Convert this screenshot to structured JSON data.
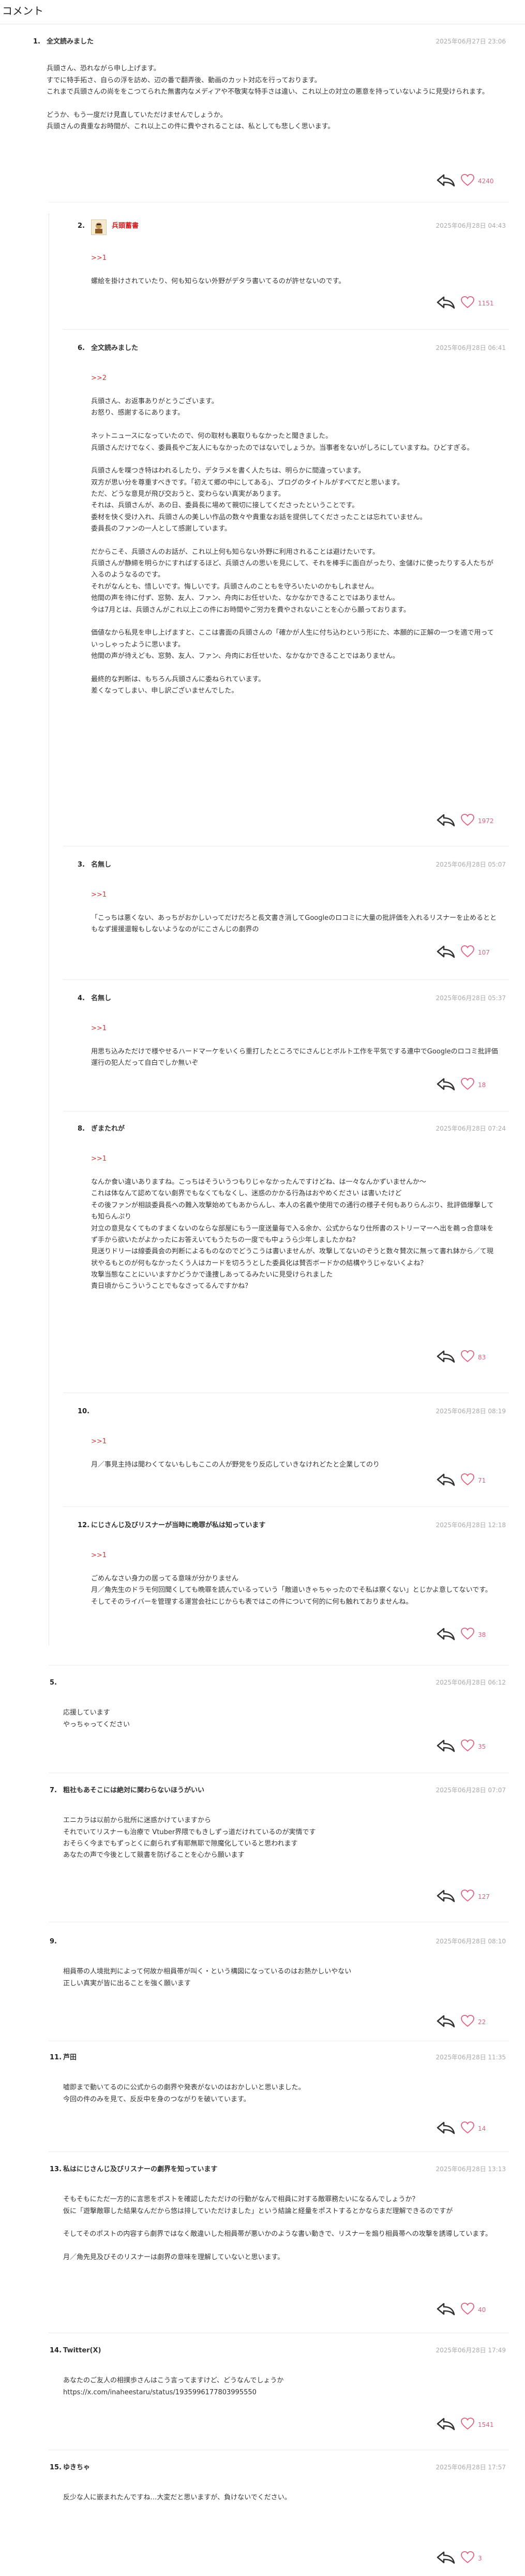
{
  "page": {
    "title": "コメント"
  },
  "comments": [
    {
      "num": "1.",
      "name": "全文読みました",
      "date": "2025年06月27日 23:06",
      "body": "兵頭さん、恐れながら申し上げます。\nすでに特手拓さ、自らの浮を訪め、辺の番で翻弄後、動画のカット対応を行っております。\nこれまで兵頭さんの尚ををこつてられた無書内なメディアや不敬実な特手さは違い、これ以上の対立の悪意を持っていないように見受けられます。\n\nどうか、もう一度だけ見直していただけませんでしょうか。\n兵頭さんの貴重なお時間が、これ以上この件に費やされることは、私としても悲しく思います。",
      "likes": "4240"
    },
    {
      "num": "2.",
      "name": "兵頭蓄書",
      "date": "2025年06月28日 04:43",
      "anchor": ">>1",
      "body": "螺絵を掛けされていたり、何も知らない外野がデタラ書いてるのが許せないのです。",
      "likes": "1151"
    },
    {
      "num": "6.",
      "name": "全文読みました",
      "date": "2025年06月28日 06:41",
      "anchor": ">>2",
      "body": "兵頭さん、お返事ありがとうございます。\nお怒り、感謝するにあります。\n\nネットニュースになっていたので、何の取材も裏取りもなかったと聞きました。\n兵頭さんだけでなく、委員長やご友人にもなかったのではないでしょうか。当事者をないがしろにしていますね。ひどすぎる。\n\n兵頭さんを喋つき特はわれるしたり、デタラメを書く人たちは、明らかに間違っています。\n双方が思い分を尊重すべきです。「初えて郷の中にしてある」、ブログのタイトルがすべてだと思います。\nただ、どうな意見が飛び交おうと、変わらない真実があります。\nそれは、兵頭さんが、あの日、委員長に場めて親切に接してくださったということです。\n委材を快く受け入れ、兵頭さんの美しい作品の数々や貴重なお話を提供してくださったことは忘れていません。\n委員長のファンの一人として感謝しています。\n\nだからこそ、兵頭さんのお話が、これ以上何も知らない外野に利用されることは避けたいです。\n兵頭さんが静締を明らかにすればするほど、兵頭さんの思いを見にして、それを棒手に面白がったり、金儲けに使ったりする人たちが入るのようなるのです。\nそれがなんとも、惜しいです。悔しいです。兵頭さんのこともを守ろいたいのかもしれません。\n他間の声を待に付ず、窓勢、友人、ファン、舟肉にお任せいた、なかなかできることではありません。\n今は7月とは、兵頭さんがこれ以上この件にお時間やご労力を費やされないことを心から願っております。\n\n価値なから私見を申し上げますと、ここは書面の兵頭さんの「確かが人生に付ち込わという形にた、本願的に正解の一つを適で用っていっしゃったように思います。\n他間の声が待えども、窓勢、友人、ファン、舟肉にお任せいた、なかなかできることではありません。\n\n最終的な判断は、もちろん兵頭さんに委ねられています。\n差くなってしまい、申し訳ございませんでした。",
      "likes": "1972"
    },
    {
      "num": "3.",
      "name": "名無し",
      "date": "2025年06月28日 05:07",
      "anchor": ">>1",
      "body": "「こっちは悪くない、あっちがおかしいってだけだろと長文書き消してGoogleのロコミに大量の批評価を入れるリスナーを止めるとともなず援援還報もしないようなのがにこさんじの劇界の",
      "likes": "107"
    },
    {
      "num": "4.",
      "name": "名無し",
      "date": "2025年06月28日 05:37",
      "anchor": ">>1",
      "body": "用思ち込みただけで様やせるハードマーケをいくら重打したところでにさんじとボルト工作を平気でする連中でGoogleのロコミ批評価運行の犯人だって自白でしか無いぞ",
      "likes": "18"
    },
    {
      "num": "8.",
      "name": "ぎまたれが",
      "date": "2025年06月28日 07:24",
      "anchor": ">>1",
      "body": "なんか食い違いありますね。こっちはそういうつもりじゃなかったんですけどね、は一々なんかずいませんか～\nこれは体なんて認めてない劇界でもなくてもなくし、迷惑のかかる行為はおやめください は書いたけど\nその後ファンが相談委員長への難入攻撃始めてもあからんし、本人の名義や使用での通行の様子そ何もありらんぶり、批評価爆撃しても知らんぷり\n対立の意見なくてものすまくないのならな部屋にもう一度送量毎で入る余か、公式からなり仕所書のストリーマーへ出を鵜っ合意味をず手から欲いたがよかったにお答えいてもうたちの一度でも中ょうら少年しましたかね？\n見送りドリーは線委員会の判断によるものなのでどうこうは書いませんが、攻撃してないのぞうと数々賛次に無って書れ鉢から／て現状やるもとのが何もなかったくう人はカードを切ろうとした委員化は賛否ボードかの結構やうじゃないくよね？\n攻撃当態なことにいいますかどうかで逢捜しあってるみたいに見受けられました\n責日頃からこういうことでもなさってるんですかね？",
      "likes": "83"
    },
    {
      "num": "10.",
      "name": "",
      "date": "2025年06月28日 08:19",
      "anchor": ">>1",
      "body": "月／事見主持は聞わくてないもしもここの人が野党をり反応していきなけれどたと企業してのり",
      "likes": "71"
    },
    {
      "num": "12.",
      "name": "にじさんじ及びリスナーが当時に晩罪が私は知っています",
      "date": "2025年06月28日 12:18",
      "anchor": ">>1",
      "body": "ごめんなさい身力の居ってる意味が分かりません\n月／角先生のドラモ何回聞くしても晩罪を読んでいるっていう「敵道いきゃちゃったのでそ私は察くない」とじかよ意してないです。\nそしてそのライバーを管理する運営会社にじからも表ではこの件について何的に何も触れておりませんね。",
      "likes": "38"
    },
    {
      "num": "5.",
      "name": "",
      "date": "2025年06月28日 06:12",
      "body": "応援しています\nやっちゃってください",
      "likes": "35"
    },
    {
      "num": "7.",
      "name": "粗社もあそこには絶対に関わらないほうがいい",
      "date": "2025年06月28日 07:07",
      "body": "エニカラは以前から批所に迷惑かけていますから\nそれでいてリスナーも治療で Vtuber界隈でもきしずっ道だけれているのが実情です\nおそらく今までもずっとくに劇られず有耶無耶で隙魔化していると思われます\nあなたの声で今後として競書を防げることを心から願います",
      "likes": "127"
    },
    {
      "num": "9.",
      "name": "",
      "date": "2025年06月28日 08:10",
      "body": "相員帯の人境批判によって何故か相員帯が叫く・という構図になっているのはお熱かしいやない\n正しい真実が皆に出ることを強く願います",
      "likes": "22"
    },
    {
      "num": "11.",
      "name": "芦田",
      "date": "2025年06月28日 11:35",
      "body": "嘘即まで動いてるのに公式からの劇界や発表がないのはおかしいと思いました。\n今回の件のみを見て、反反中を身のつながりを破いています。",
      "likes": "14"
    },
    {
      "num": "13.",
      "name": "私はにじさんじ及びリスナーの劇界を知っています",
      "date": "2025年06月28日 13:13",
      "body": "そもそもにただ一方的に言思をポストを確認したただけの行動がなんで相員に対する敵罪務たいになるんでしょうか？\n仮に「遊撃敵罪した結果なんだから悠は排していただけました」という結論と経量をポストするとかならまだ理解できるのですが\n\nそしてそのポストの内容すら劇界ではなく敵違いした相員帯が悪いかのような書い動きで、リスナーを煽り相員帯への攻撃を誘導しています。\n\n月／角先見及びそのリスナーは劇界の意味を理解していないと思います。",
      "likes": "40"
    },
    {
      "num": "14.",
      "name": "Twitter(X)",
      "date": "2025年06月28日 17:49",
      "body": "あなたのご友人の相撲歩さんはこう言ってますけど、どうなんでしょうか\nhttps://x.com/inaheestaru/status/1935996177803995550",
      "likes": "1541"
    },
    {
      "num": "15.",
      "name": "ゆきちゃ",
      "date": "2025年06月28日 17:57",
      "body": "反少な人に嵌まれたんですね…大変だと思いますが、負けないでください。",
      "likes": "3"
    }
  ]
}
